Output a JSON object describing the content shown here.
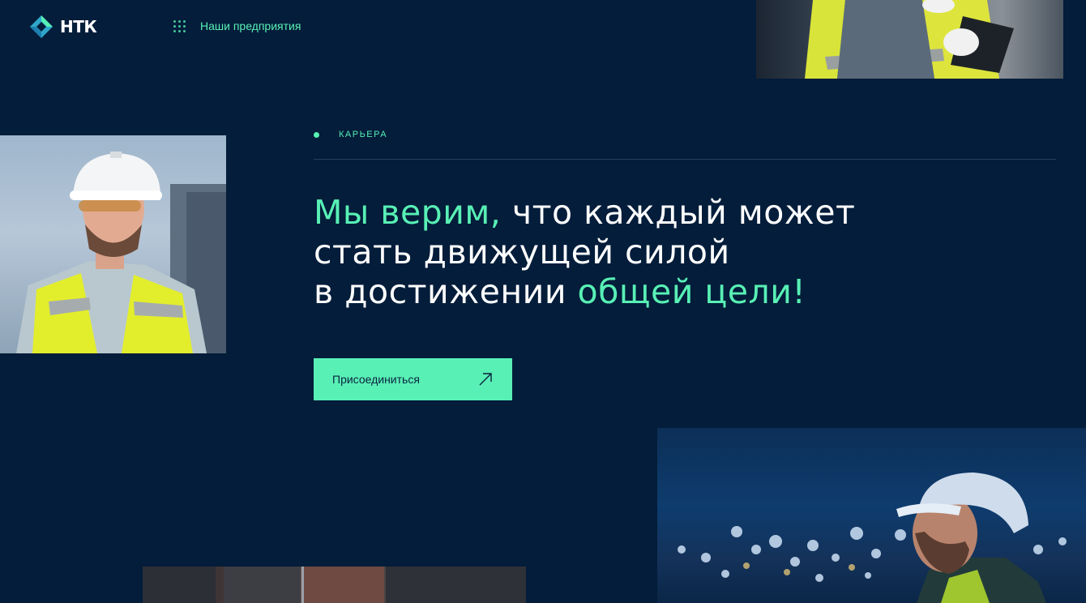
{
  "header": {
    "logo_text": "НТК",
    "enterprises_label": "Наши предприятия",
    "icons": {
      "logo": "ntk-logo-icon",
      "enterprises": "grid-dots-icon",
      "menu": "hamburger-menu-icon"
    }
  },
  "hero": {
    "section_label": "КАРЬЕРА",
    "headline": {
      "part1_accent": "Мы верим,",
      "part1_rest": " что каждый может",
      "line2": "стать движущей силой",
      "line3_start": "в достижении ",
      "line3_accent": "общей цели!"
    },
    "cta_label": "Присоединиться",
    "cta_icon": "arrow-up-right-icon"
  },
  "photos": {
    "top": "worker-with-tablet-photo",
    "left": "worker-in-hardhat-photo",
    "bottom_right": "worker-at-night-photo",
    "bottom_left": "industrial-photo"
  },
  "colors": {
    "background": "#031d3a",
    "accent": "#58f0b5",
    "text": "#ffffff"
  }
}
